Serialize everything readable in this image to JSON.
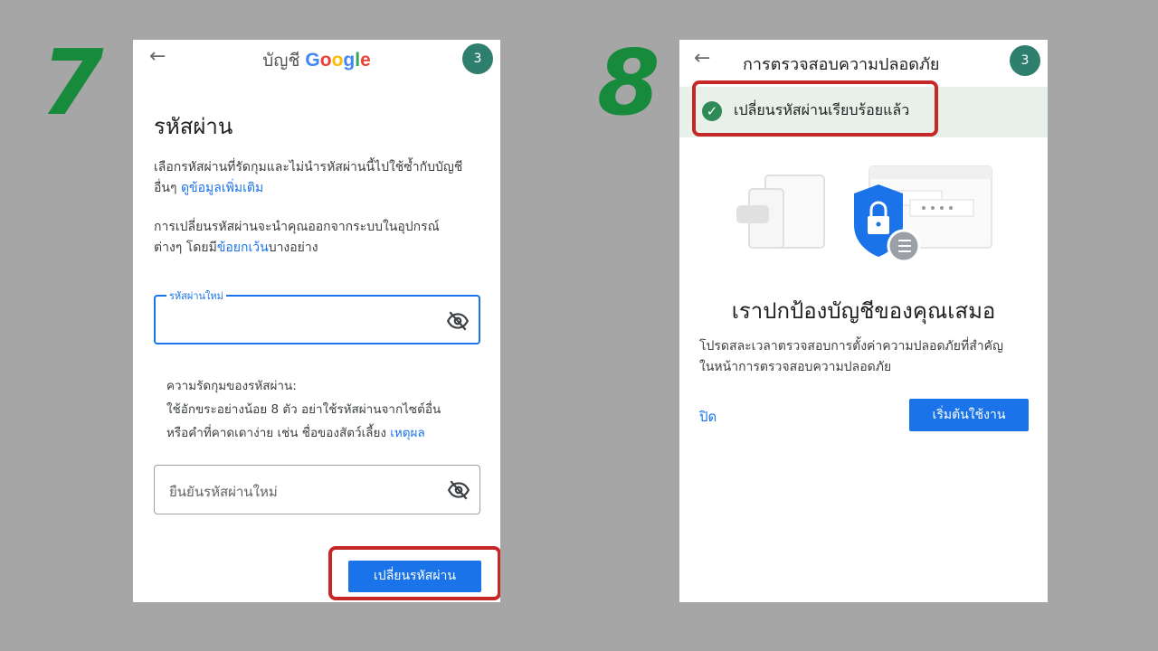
{
  "step_left": "7",
  "step_right": "8",
  "left": {
    "header_prefix": "บัญชี",
    "brand_letters": [
      {
        "ch": "G",
        "color": "#4285F4"
      },
      {
        "ch": "o",
        "color": "#EA4335"
      },
      {
        "ch": "o",
        "color": "#FBBC05"
      },
      {
        "ch": "g",
        "color": "#4285F4"
      },
      {
        "ch": "l",
        "color": "#34A853"
      },
      {
        "ch": "e",
        "color": "#EA4335"
      }
    ],
    "avatar": "3",
    "title": "รหัสผ่าน",
    "desc1_text": "เลือกรหัสผ่านที่รัดกุมและไม่นำรหัสผ่านนี้ไปใช้ซ้ำกับบัญชีอื่นๆ ",
    "desc1_link": "ดูข้อมูลเพิ่มเติม",
    "desc2_line1": "การเปลี่ยนรหัสผ่านจะนำคุณออกจากระบบในอุปกรณ์",
    "desc2_prefix": "ต่างๆ โดยมี",
    "desc2_link": "ข้อยกเว้น",
    "desc2_suffix": "บางอย่าง",
    "new_password_label": "รหัสผ่านใหม่",
    "strength_title": "ความรัดกุมของรหัสผ่าน:",
    "strength_line1": "ใช้อักขระอย่างน้อย 8 ตัว อย่าใช้รหัสผ่านจากไซต์อื่น",
    "strength_line2": "หรือคำที่คาดเดาง่าย เช่น ชื่อของสัตว์เลี้ยง ",
    "strength_link": "เหตุผล",
    "confirm_placeholder": "ยืนยันรหัสผ่านใหม่",
    "change_button": "เปลี่ยนรหัสผ่าน"
  },
  "right": {
    "title": "การตรวจสอบความปลอดภัย",
    "avatar": "3",
    "banner": "เปลี่ยนรหัสผ่านเรียบร้อยแล้ว",
    "heading": "เราปกป้องบัญชีของคุณเสมอ",
    "desc_line1": "โปรดสละเวลาตรวจสอบการตั้งค่าความปลอดภัยที่สำคัญ",
    "desc_line2": "ในหน้าการตรวจสอบความปลอดภัย",
    "close": "ปิด",
    "start_button": "เริ่มต้นใช้งาน"
  }
}
